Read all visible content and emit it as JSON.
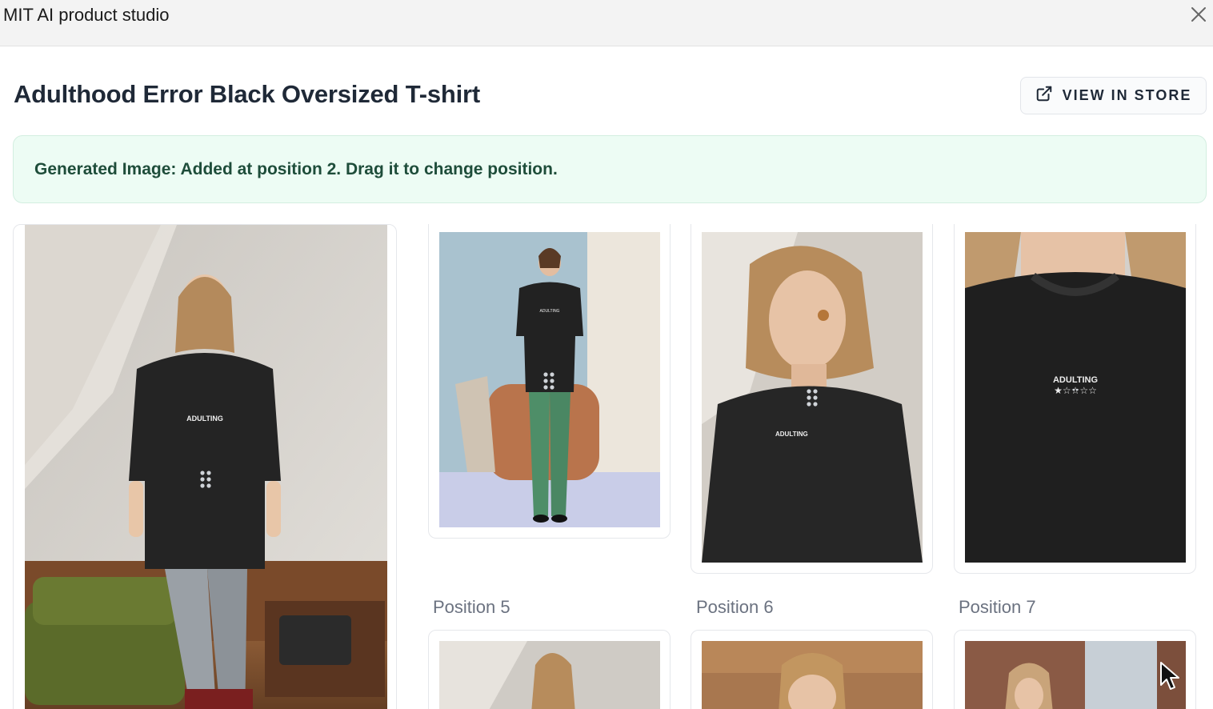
{
  "window": {
    "title": "MIT AI product studio",
    "close_icon": "close-icon"
  },
  "header": {
    "product_title": "Adulthood Error Black Oversized T-shirt",
    "store_button_label": "VIEW IN STORE",
    "store_button_icon": "external-link-icon"
  },
  "banner": {
    "message": "Generated Image: Added at position 2. Drag it to change position.",
    "background": "#edfcf4",
    "text_color": "#1e4d3a"
  },
  "gallery": {
    "images": [
      {
        "description": "model full body in living room",
        "icon": "drag-handle-icon"
      },
      {
        "description": "model full body in studio",
        "icon": "drag-handle-icon"
      },
      {
        "description": "model chest close-up",
        "icon": "drag-handle-icon"
      },
      {
        "description": "t-shirt print close-up",
        "icon": "drag-handle-icon"
      }
    ],
    "position_labels": [
      "Position 5",
      "Position 6",
      "Position 7"
    ],
    "shirt_print_text": "ADULTING"
  }
}
